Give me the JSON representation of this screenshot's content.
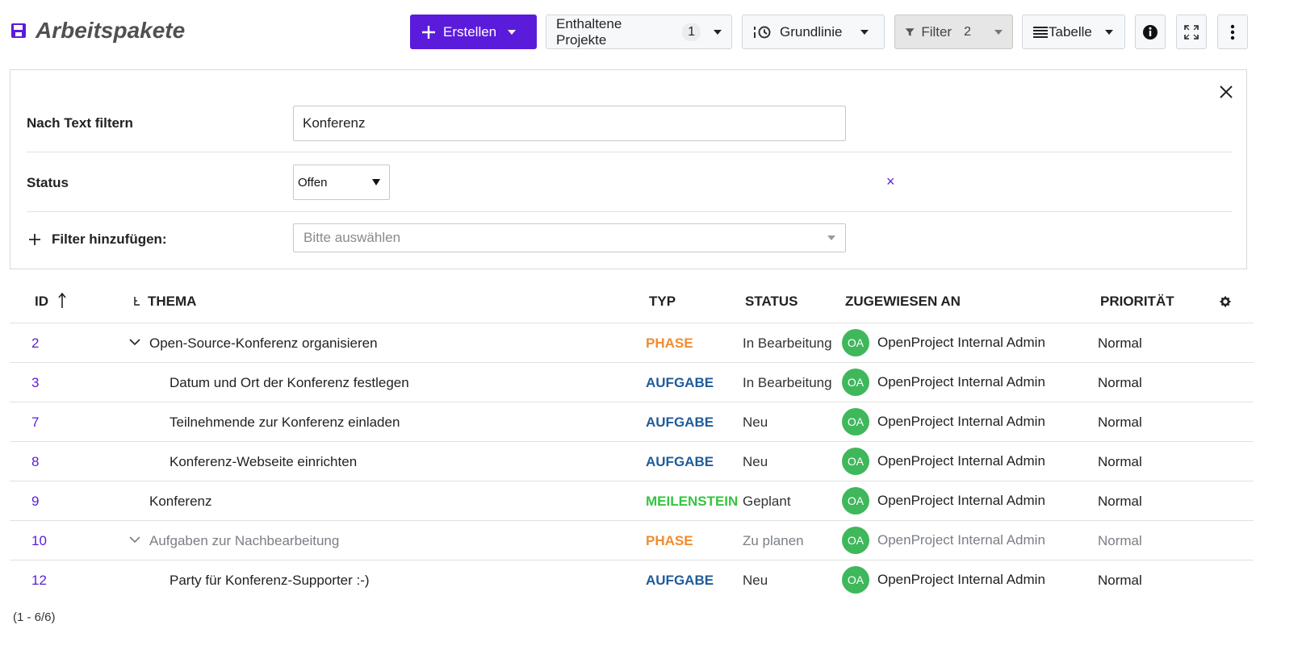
{
  "header": {
    "title": "Arbeitspakete",
    "create_label": "Erstellen",
    "projects_label": "Enthaltene Projekte",
    "projects_count": "1",
    "baseline_label": "Grundlinie",
    "filter_label": "Filter",
    "filter_count": "2",
    "view_label": "Tabelle"
  },
  "filters": {
    "text_label": "Nach Text filtern",
    "text_value": "Konferenz",
    "status_label": "Status",
    "status_value": "Offen",
    "remove_symbol": "×",
    "add_label": "Filter hinzufügen:",
    "add_placeholder": "Bitte auswählen"
  },
  "table": {
    "columns": {
      "id": "ID",
      "subject": "THEMA",
      "type": "TYP",
      "status": "STATUS",
      "assignee": "ZUGEWIESEN AN",
      "priority": "PRIORITÄT"
    },
    "rows": [
      {
        "id": "2",
        "subject": "Open-Source-Konferenz organisieren",
        "type": "PHASE",
        "status": "In Bearbeitung",
        "initials": "OA",
        "assignee": "OpenProject Internal Admin",
        "priority": "Normal"
      },
      {
        "id": "3",
        "subject": "Datum und Ort der Konferenz festlegen",
        "type": "AUFGABE",
        "status": "In Bearbeitung",
        "initials": "OA",
        "assignee": "OpenProject Internal Admin",
        "priority": "Normal"
      },
      {
        "id": "7",
        "subject": "Teilnehmende zur Konferenz einladen",
        "type": "AUFGABE",
        "status": "Neu",
        "initials": "OA",
        "assignee": "OpenProject Internal Admin",
        "priority": "Normal"
      },
      {
        "id": "8",
        "subject": "Konferenz-Webseite einrichten",
        "type": "AUFGABE",
        "status": "Neu",
        "initials": "OA",
        "assignee": "OpenProject Internal Admin",
        "priority": "Normal"
      },
      {
        "id": "9",
        "subject": "Konferenz",
        "type": "MEILENSTEIN",
        "status": "Geplant",
        "initials": "OA",
        "assignee": "OpenProject Internal Admin",
        "priority": "Normal"
      },
      {
        "id": "10",
        "subject": "Aufgaben zur Nachbearbeitung",
        "type": "PHASE",
        "status": "Zu planen",
        "initials": "OA",
        "assignee": "OpenProject Internal Admin",
        "priority": "Normal"
      },
      {
        "id": "12",
        "subject": "Party für Konferenz-Supporter :-)",
        "type": "AUFGABE",
        "status": "Neu",
        "initials": "OA",
        "assignee": "OpenProject Internal Admin",
        "priority": "Normal"
      }
    ],
    "footer": "(1 - 6/6)"
  },
  "colors": {
    "accent": "#5b1bdb",
    "phase": "#f08c30",
    "task": "#1f5c9a",
    "milestone": "#35c53f",
    "avatar": "#3fb75b"
  }
}
